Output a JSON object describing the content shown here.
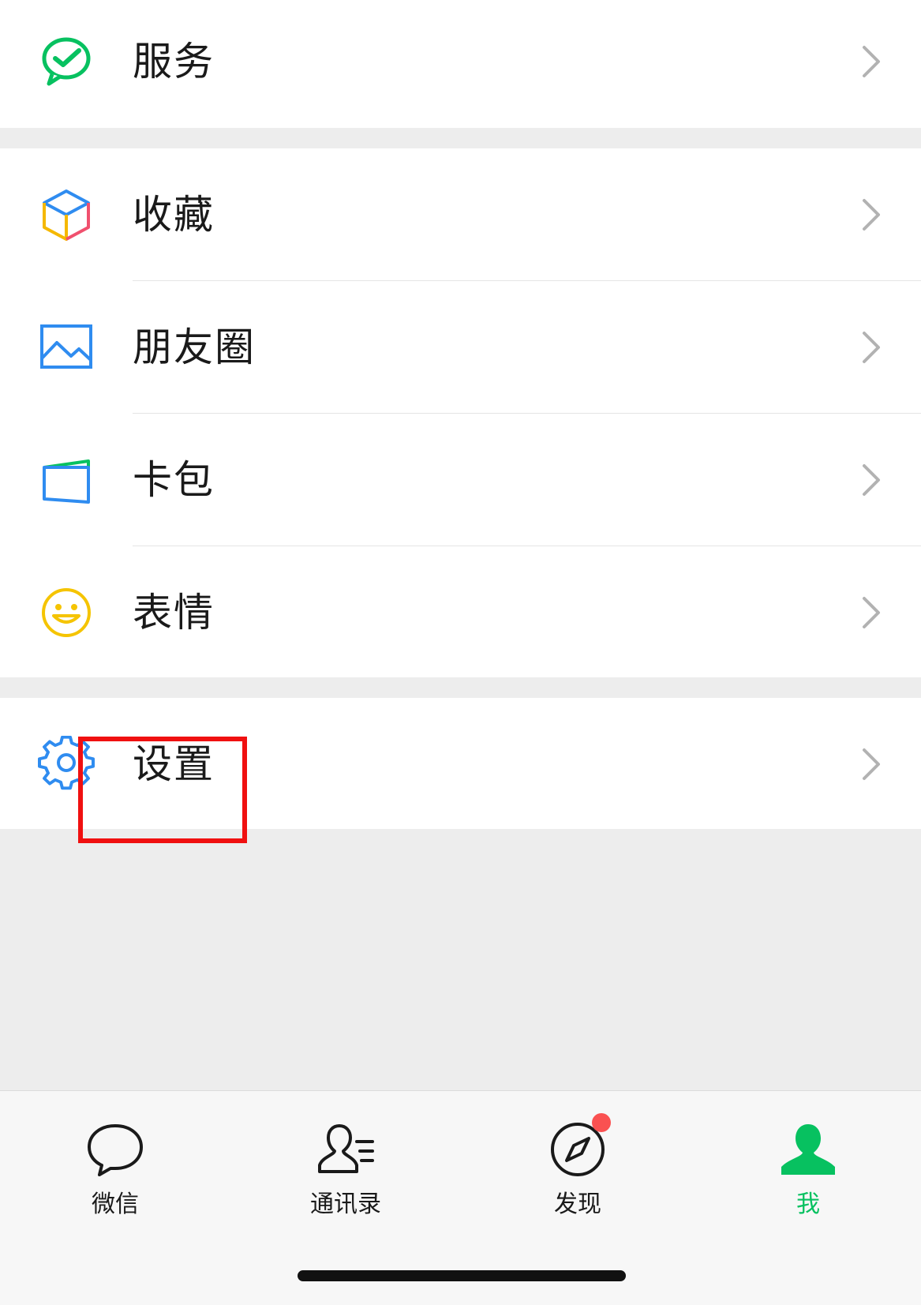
{
  "colors": {
    "page_bg": "#ededed",
    "accent_green": "#07c160",
    "text": "#1a1a1a",
    "chevron": "#b2b2b2",
    "badge": "#fa5151",
    "highlight": "#f01010"
  },
  "menu": {
    "services": {
      "label": "服务",
      "icon": "wechat-pay-check-icon"
    },
    "favorites": {
      "label": "收藏",
      "icon": "cube-icon"
    },
    "moments": {
      "label": "朋友圈",
      "icon": "picture-icon"
    },
    "cards": {
      "label": "卡包",
      "icon": "wallet-card-icon"
    },
    "stickers": {
      "label": "表情",
      "icon": "smiley-icon"
    },
    "settings": {
      "label": "设置",
      "icon": "gear-icon"
    }
  },
  "tabbar": {
    "tabs": [
      {
        "label": "微信",
        "icon": "chat-bubble-icon",
        "active": false
      },
      {
        "label": "通讯录",
        "icon": "contacts-icon",
        "active": false
      },
      {
        "label": "发现",
        "icon": "compass-icon",
        "active": false,
        "badge_dot": true
      },
      {
        "label": "我",
        "icon": "person-icon",
        "active": true
      }
    ]
  }
}
